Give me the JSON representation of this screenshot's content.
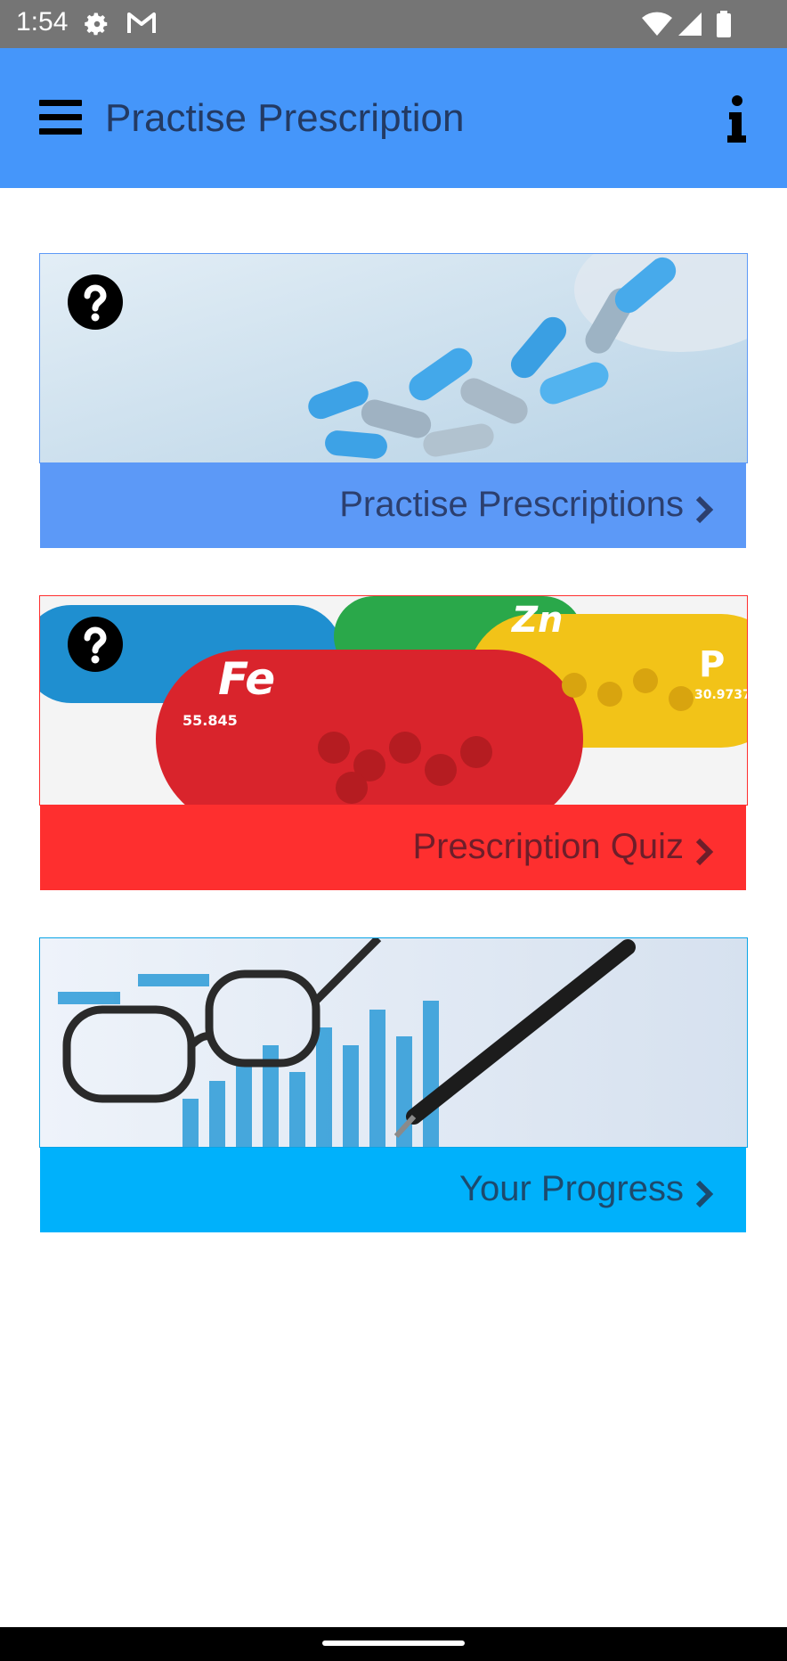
{
  "status_bar": {
    "time": "1:54",
    "icons": [
      "gear-icon",
      "gmail-icon",
      "wifi-icon",
      "signal-icon",
      "battery-icon"
    ]
  },
  "app_bar": {
    "title": "Practise Prescription",
    "menu_icon": "hamburger-menu-icon",
    "info_icon": "info-icon",
    "background": "#4596fa"
  },
  "cards": [
    {
      "label": "Practise Prescriptions",
      "label_bg": "#5c99f7",
      "label_color": "#2c3f6e",
      "border_color": "#5c99f7",
      "image": "blue-capsules-image",
      "has_help": true
    },
    {
      "label": "Prescription Quiz",
      "label_bg": "#fe2f2f",
      "label_color": "#6e1e2a",
      "border_color": "#fe2f2f",
      "image": "mineral-capsules-image",
      "has_help": true
    },
    {
      "label": "Your Progress",
      "label_bg": "#00b1fb",
      "label_color": "#1d4a6d",
      "border_color": "#0aa4e6",
      "image": "glasses-pen-chart-image",
      "has_help": false
    }
  ]
}
